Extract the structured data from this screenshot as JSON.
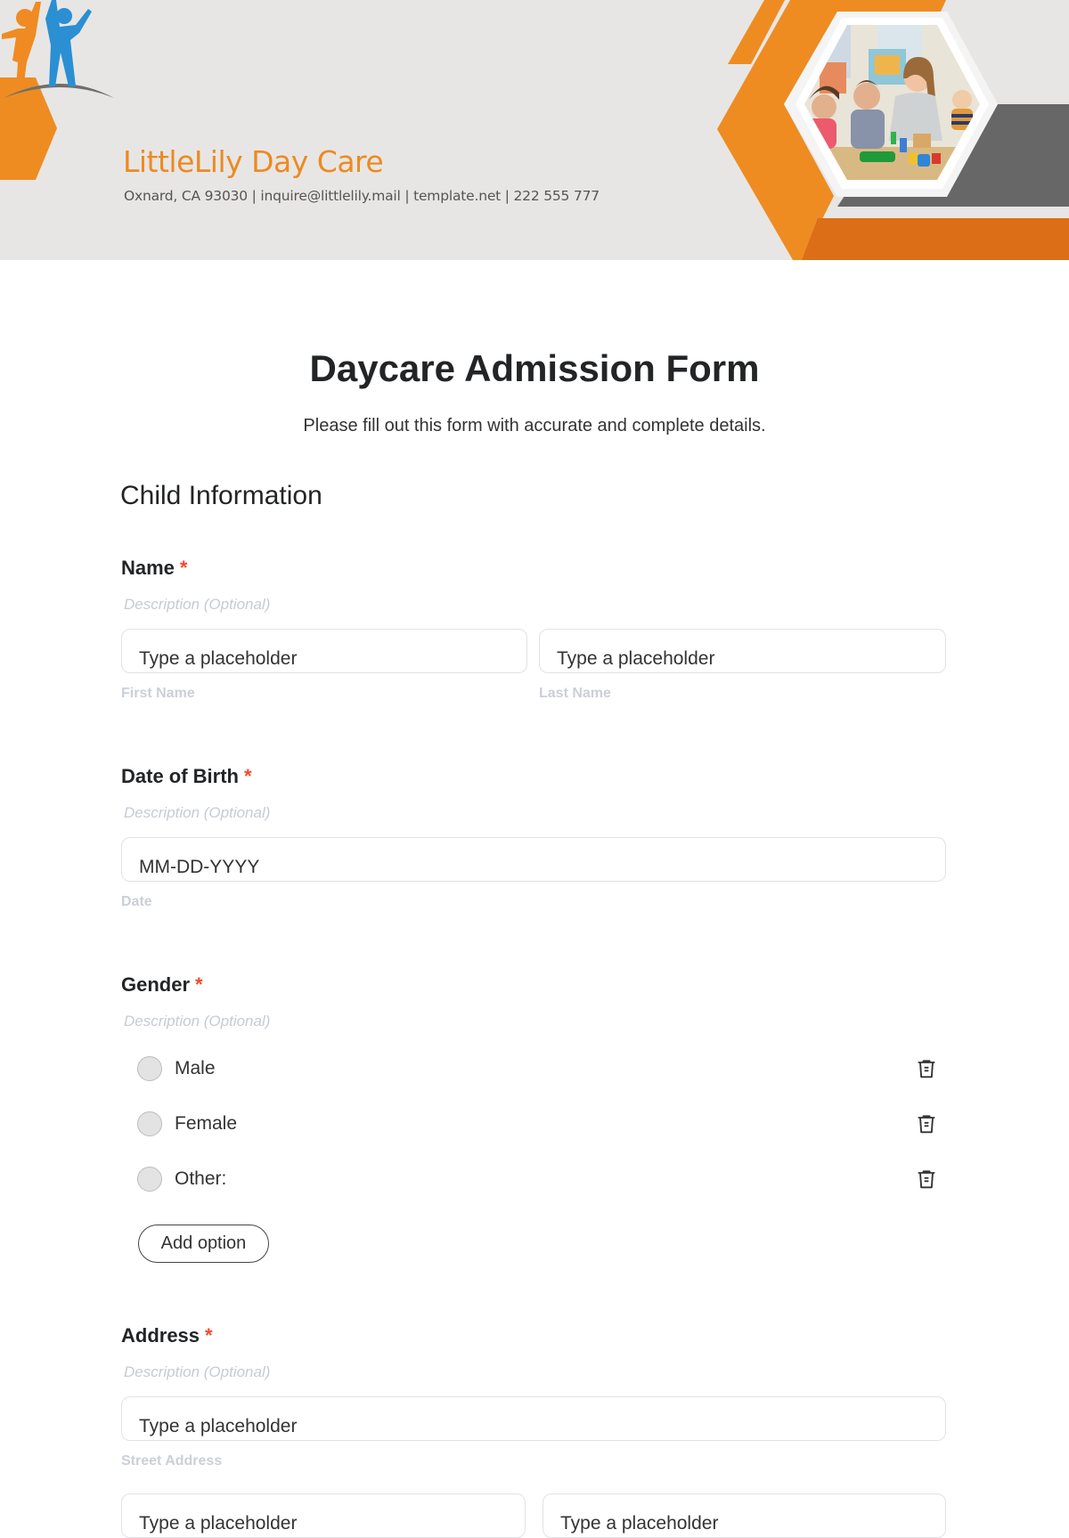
{
  "header": {
    "company_name": "LittleLily Day Care",
    "contact_line": "Oxnard, CA 93030 | inquire@littlelily.mail | template.net | 222 555 777",
    "colors": {
      "orange": "#ec8a22",
      "dark_orange": "#d96d16",
      "gray": "#666666",
      "background": "#e8e6e4",
      "logo_blue": "#2a8fd3"
    },
    "photo_alt": "Teacher playing with children at a table with building toys"
  },
  "form": {
    "title": "Daycare Admission Form",
    "subtitle": "Please fill out this form with accurate and complete details.",
    "section_title": "Child Information",
    "required_marker": "*",
    "questions": {
      "name": {
        "label": "Name",
        "description": "Description (Optional)",
        "first_placeholder": "Type a placeholder",
        "first_sublabel": "First Name",
        "last_placeholder": "Type a placeholder",
        "last_sublabel": "Last Name"
      },
      "dob": {
        "label": "Date of Birth",
        "description": "Description (Optional)",
        "placeholder": "MM-DD-YYYY",
        "sublabel": "Date"
      },
      "gender": {
        "label": "Gender",
        "description": "Description (Optional)",
        "options": [
          "Male",
          "Female",
          "Other:"
        ],
        "add_option_label": "Add option"
      },
      "address": {
        "label": "Address",
        "description": "Description (Optional)",
        "street_placeholder": "Type a placeholder",
        "street_sublabel": "Street Address",
        "line2_left_placeholder": "Type a placeholder",
        "line2_right_placeholder": "Type a placeholder"
      }
    }
  }
}
